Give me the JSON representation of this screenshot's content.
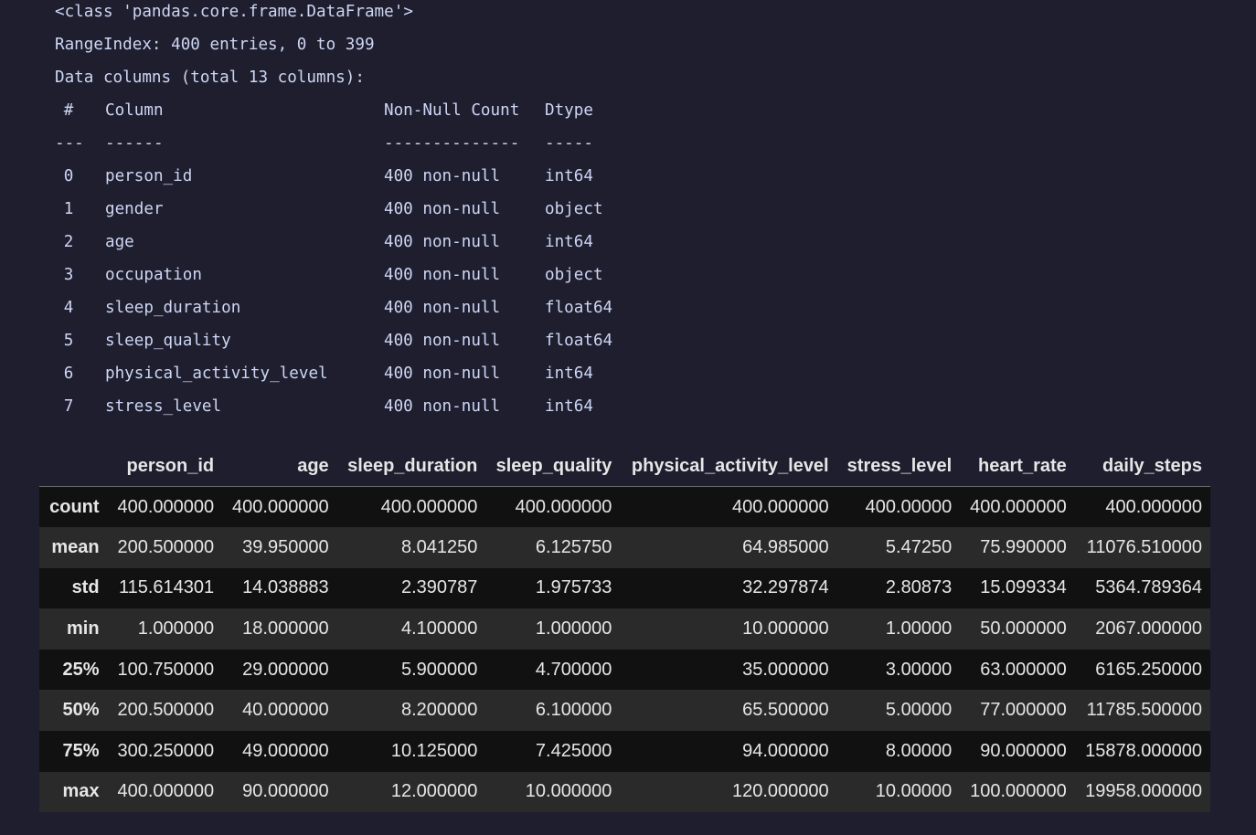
{
  "info": {
    "class_line": "<class 'pandas.core.frame.DataFrame'>",
    "range_line": "RangeIndex: 400 entries, 0 to 399",
    "columns_line": "Data columns (total 13 columns):",
    "header": {
      "idx": "#",
      "column": "Column",
      "non_null": "Non-Null Count",
      "dtype": "Dtype"
    },
    "separator": {
      "idx": "---",
      "column": "------",
      "non_null": "--------------",
      "dtype": "-----"
    },
    "rows": [
      {
        "idx": "0",
        "column": "person_id",
        "non_null": "400 non-null",
        "dtype": "int64"
      },
      {
        "idx": "1",
        "column": "gender",
        "non_null": "400 non-null",
        "dtype": "object"
      },
      {
        "idx": "2",
        "column": "age",
        "non_null": "400 non-null",
        "dtype": "int64"
      },
      {
        "idx": "3",
        "column": "occupation",
        "non_null": "400 non-null",
        "dtype": "object"
      },
      {
        "idx": "4",
        "column": "sleep_duration",
        "non_null": "400 non-null",
        "dtype": "float64"
      },
      {
        "idx": "5",
        "column": "sleep_quality",
        "non_null": "400 non-null",
        "dtype": "float64"
      },
      {
        "idx": "6",
        "column": "physical_activity_level",
        "non_null": "400 non-null",
        "dtype": "int64"
      },
      {
        "idx": "7",
        "column": "stress_level",
        "non_null": "400 non-null",
        "dtype": "int64"
      }
    ]
  },
  "describe": {
    "columns": [
      "",
      "person_id",
      "age",
      "sleep_duration",
      "sleep_quality",
      "physical_activity_level",
      "stress_level",
      "heart_rate",
      "daily_steps"
    ],
    "rows": [
      {
        "label": "count",
        "values": [
          "400.000000",
          "400.000000",
          "400.000000",
          "400.000000",
          "400.000000",
          "400.00000",
          "400.000000",
          "400.000000"
        ]
      },
      {
        "label": "mean",
        "values": [
          "200.500000",
          "39.950000",
          "8.041250",
          "6.125750",
          "64.985000",
          "5.47250",
          "75.990000",
          "11076.510000"
        ]
      },
      {
        "label": "std",
        "values": [
          "115.614301",
          "14.038883",
          "2.390787",
          "1.975733",
          "32.297874",
          "2.80873",
          "15.099334",
          "5364.789364"
        ]
      },
      {
        "label": "min",
        "values": [
          "1.000000",
          "18.000000",
          "4.100000",
          "1.000000",
          "10.000000",
          "1.00000",
          "50.000000",
          "2067.000000"
        ]
      },
      {
        "label": "25%",
        "values": [
          "100.750000",
          "29.000000",
          "5.900000",
          "4.700000",
          "35.000000",
          "3.00000",
          "63.000000",
          "6165.250000"
        ]
      },
      {
        "label": "50%",
        "values": [
          "200.500000",
          "40.000000",
          "8.200000",
          "6.100000",
          "65.500000",
          "5.00000",
          "77.000000",
          "11785.500000"
        ]
      },
      {
        "label": "75%",
        "values": [
          "300.250000",
          "49.000000",
          "10.125000",
          "7.425000",
          "94.000000",
          "8.00000",
          "90.000000",
          "15878.000000"
        ]
      },
      {
        "label": "max",
        "values": [
          "400.000000",
          "90.000000",
          "12.000000",
          "10.000000",
          "120.000000",
          "10.00000",
          "100.000000",
          "19958.000000"
        ]
      }
    ]
  },
  "colors": {
    "background": "#1e1e2e",
    "row_dark": "#111111",
    "row_light": "#2a2a2a",
    "text": "#e6e6e6"
  }
}
